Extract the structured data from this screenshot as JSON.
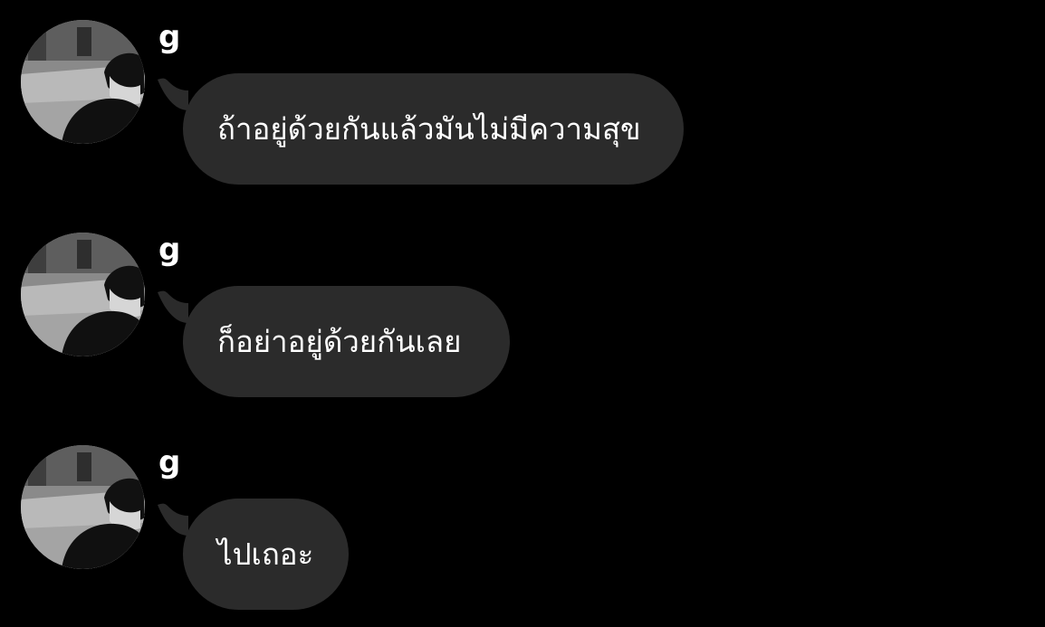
{
  "chat": {
    "messages": [
      {
        "sender": "g",
        "text": "ถ้าอยู่ด้วยกันแล้วมันไม่มีความสุข"
      },
      {
        "sender": "g",
        "text": "ก็อย่าอยู่ด้วยกันเลย"
      },
      {
        "sender": "g",
        "text": "ไปเถอะ"
      }
    ]
  },
  "icons": {
    "avatar": "profile-photo-grayscale"
  },
  "colors": {
    "background": "#000000",
    "bubble": "#2b2b2b",
    "text": "#ffffff"
  }
}
